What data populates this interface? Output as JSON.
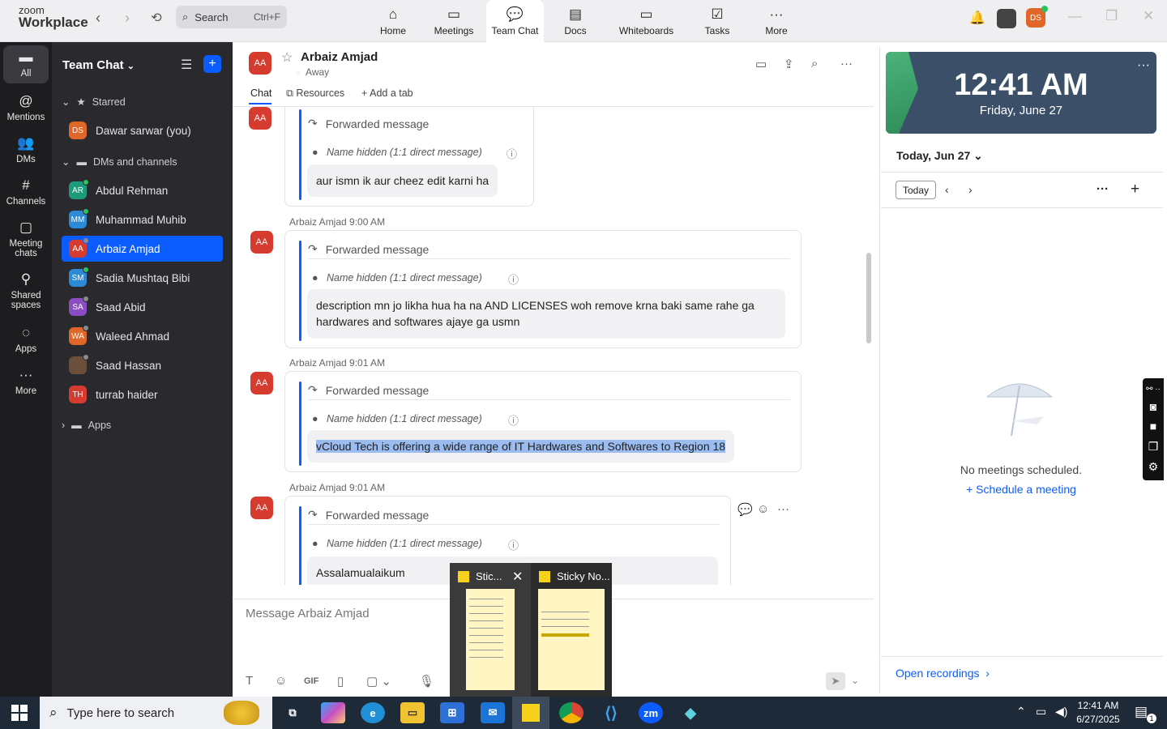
{
  "app": {
    "logo_line1": "zoom",
    "logo_line2": "Workplace"
  },
  "search": {
    "placeholder": "Search",
    "shortcut": "Ctrl+F"
  },
  "nav_tabs": [
    {
      "label": "Home"
    },
    {
      "label": "Meetings"
    },
    {
      "label": "Team Chat"
    },
    {
      "label": "Docs"
    },
    {
      "label": "Whiteboards"
    },
    {
      "label": "Tasks"
    },
    {
      "label": "More"
    }
  ],
  "user_avatar": "DS",
  "rail": [
    {
      "label": "All"
    },
    {
      "label": "Mentions"
    },
    {
      "label": "DMs"
    },
    {
      "label": "Channels"
    },
    {
      "label": "Meeting chats"
    },
    {
      "label": "Shared spaces"
    },
    {
      "label": "Apps"
    },
    {
      "label": "More"
    }
  ],
  "sidebar": {
    "title": "Team Chat",
    "starred_label": "Starred",
    "starred": [
      {
        "initials": "DS",
        "name": "Dawar sarwar (you)",
        "color": "#e0662a"
      }
    ],
    "dms_label": "DMs and channels",
    "dms": [
      {
        "initials": "AR",
        "name": "Abdul Rehman",
        "color": "#1e9b7a"
      },
      {
        "initials": "MM",
        "name": "Muhammad Muhib",
        "color": "#2d8ad6"
      },
      {
        "initials": "AA",
        "name": "Arbaiz Amjad",
        "color": "#d63b2f"
      },
      {
        "initials": "SM",
        "name": "Sadia Mushtaq Bibi",
        "color": "#2d8ad6"
      },
      {
        "initials": "SA",
        "name": "Saad Abid",
        "color": "#8a4dc2"
      },
      {
        "initials": "WA",
        "name": "Waleed Ahmad",
        "color": "#e0662a"
      },
      {
        "initials": "",
        "name": "Saad Hassan",
        "color": "#6b4f3a"
      },
      {
        "initials": "TH",
        "name": "turrab haider",
        "color": "#d63b2f"
      }
    ],
    "apps_label": "Apps"
  },
  "chat": {
    "avatar": "AA",
    "name": "Arbaiz Amjad",
    "status": "Away",
    "tabs": {
      "chat": "Chat",
      "resources": "Resources",
      "add": "Add a tab"
    },
    "fwd_label": "Forwarded message",
    "name_hidden": "Name hidden (1:1 direct message)",
    "messages": [
      {
        "meta": "",
        "text": "aur ismn ik aur cheez edit karni ha"
      },
      {
        "meta": "Arbaiz Amjad 9:00 AM",
        "text": "description mn jo likha hua ha na AND LICENSES woh remove krna baki same rahe ga hardwares and softwares ajaye ga usmn"
      },
      {
        "meta": "Arbaiz Amjad 9:01 AM",
        "text": "vCloud Tech is offering a wide range of IT Hardwares and Softwares  to Region 18"
      },
      {
        "meta": "Arbaiz Amjad 9:01 AM",
        "text": "Assalamualaikum"
      }
    ],
    "input_placeholder": "Message Arbaiz Amjad",
    "gif_label": "GIF"
  },
  "right_panel": {
    "time": "12:41 AM",
    "date": "Friday, June 27",
    "today_header": "Today, Jun 27",
    "today_button": "Today",
    "no_meetings": "No meetings scheduled.",
    "schedule": "Schedule a meeting",
    "open_recordings": "Open recordings"
  },
  "thumbnails": [
    {
      "title": "Stic..."
    },
    {
      "title": "Sticky No..."
    }
  ],
  "taskbar": {
    "search_placeholder": "Type here to search",
    "time": "12:41 AM",
    "date": "6/27/2025",
    "notification_count": "1"
  }
}
